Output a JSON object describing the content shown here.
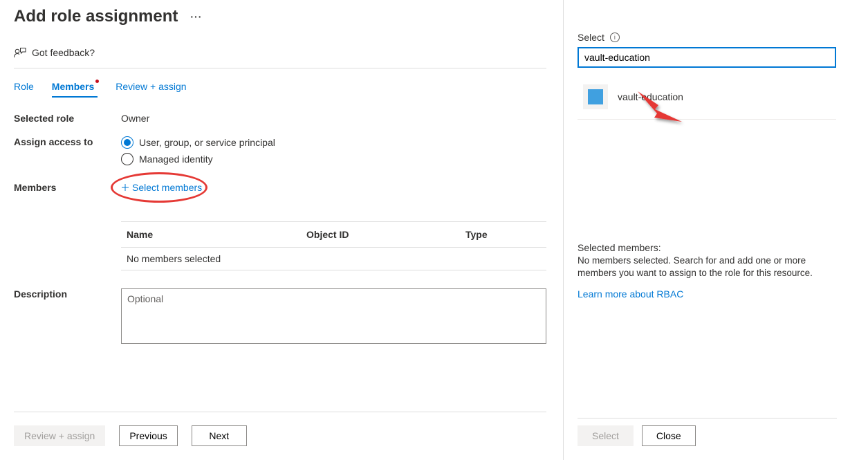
{
  "page_title": "Add role assignment",
  "feedback_label": "Got feedback?",
  "tabs": {
    "role": "Role",
    "members": "Members",
    "review": "Review + assign"
  },
  "form": {
    "selected_role_label": "Selected role",
    "selected_role_value": "Owner",
    "assign_access_label": "Assign access to",
    "radio_user_group": "User, group, or service principal",
    "radio_managed_identity": "Managed identity",
    "members_label": "Members",
    "select_members_label": "Select members",
    "description_label": "Description",
    "description_placeholder": "Optional"
  },
  "table": {
    "name_header": "Name",
    "objectid_header": "Object ID",
    "type_header": "Type",
    "empty_text": "No members selected"
  },
  "footer": {
    "review_assign": "Review + assign",
    "previous": "Previous",
    "next": "Next"
  },
  "panel": {
    "select_label": "Select",
    "search_value": "vault-education",
    "result_name": "vault-education",
    "selected_members_label": "Selected members:",
    "selected_members_text": "No members selected. Search for and add one or more members you want to assign to the role for this resource.",
    "learn_more": "Learn more about RBAC",
    "select_button": "Select",
    "close_button": "Close"
  }
}
